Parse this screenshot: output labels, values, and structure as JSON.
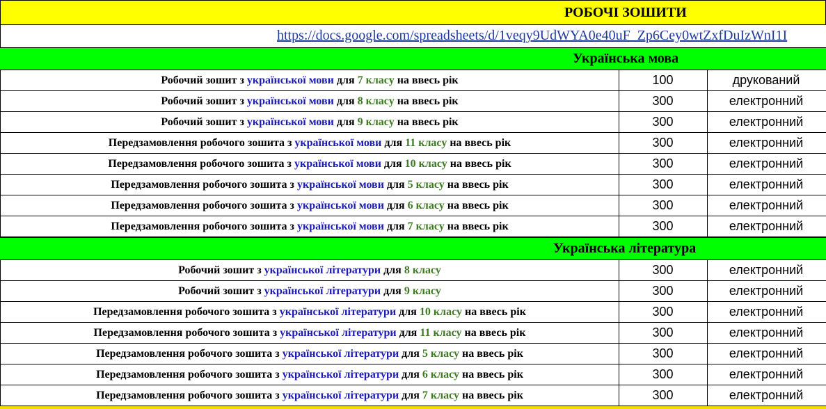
{
  "title": "РОБОЧІ ЗОШИТИ",
  "link": "https://docs.google.com/spreadsheets/d/1veqy9UdWYA0e40uF_Zp6Cey0wtZxfDuIzWnI1I",
  "colors": {
    "title_bg": "#ffff00",
    "section_bg": "#00ff00",
    "subject_text": "#1c1cb4",
    "class_text": "#3d7a22"
  },
  "sections": [
    {
      "title": "Українська мова",
      "items": [
        {
          "pre": "Робочий зошит з",
          "subject": "української мови",
          "mid": "для",
          "cls": "7 класу",
          "post": "на ввесь рік",
          "price": "100",
          "type": "друкований"
        },
        {
          "pre": "Робочий зошит з",
          "subject": "української мови",
          "mid": "для",
          "cls": "8 класу",
          "post": "на ввесь рік",
          "price": "300",
          "type": "електронний"
        },
        {
          "pre": "Робочий зошит з",
          "subject": "української мови",
          "mid": "для",
          "cls": "9 класу",
          "post": "на ввесь рік",
          "price": "300",
          "type": "електронний"
        },
        {
          "pre": "Передзамовлення робочого зошита з",
          "subject": "української мови",
          "mid": "для",
          "cls": "11 класу",
          "post": "на ввесь рік",
          "price": "300",
          "type": "електронний"
        },
        {
          "pre": "Передзамовлення робочого зошита з",
          "subject": "української мови",
          "mid": "для",
          "cls": "10 класу",
          "post": "на ввесь рік",
          "price": "300",
          "type": "електронний"
        },
        {
          "pre": "Передзамовлення робочого зошита з",
          "subject": "української мови",
          "mid": "для",
          "cls": "5 класу",
          "post": "на ввесь рік",
          "price": "300",
          "type": "електронний"
        },
        {
          "pre": "Передзамовлення робочого зошита з",
          "subject": "української мови",
          "mid": "для",
          "cls": "6 класу",
          "post": "на ввесь рік",
          "price": "300",
          "type": "електронний"
        },
        {
          "pre": "Передзамовлення робочого зошита з",
          "subject": "української мови",
          "mid": "для",
          "cls": "7 класу",
          "post": "на ввесь рік",
          "price": "300",
          "type": "електронний"
        }
      ]
    },
    {
      "title": "Українська література",
      "items": [
        {
          "pre": "Робочий зошит з",
          "subject": "української літератури",
          "mid": "для",
          "cls": "8 класу",
          "post": "",
          "price": "300",
          "type": "електронний"
        },
        {
          "pre": "Робочий зошит з",
          "subject": "української літератури",
          "mid": "для",
          "cls": "9 класу",
          "post": "",
          "price": "300",
          "type": "електронний"
        },
        {
          "pre": "Передзамовлення робочого зошита з",
          "subject": "української літератури",
          "mid": "для",
          "cls": "10 класу",
          "post": "на ввесь рік",
          "price": "300",
          "type": "електронний"
        },
        {
          "pre": "Передзамовлення робочого зошита з",
          "subject": "української літератури",
          "mid": "для",
          "cls": "11 класу",
          "post": "на ввесь рік",
          "price": "300",
          "type": "електронний"
        },
        {
          "pre": "Передзамовлення робочого зошита з",
          "subject": "української літератури",
          "mid": "для",
          "cls": "5 класу",
          "post": "на ввесь рік",
          "price": "300",
          "type": "електронний"
        },
        {
          "pre": "Передзамовлення робочого зошита з",
          "subject": "української літератури",
          "mid": "для",
          "cls": "6 класу",
          "post": "на ввесь рік",
          "price": "300",
          "type": "електронний"
        },
        {
          "pre": "Передзамовлення робочого зошита з",
          "subject": "української літератури",
          "mid": "для",
          "cls": "7 класу",
          "post": "на ввесь рік",
          "price": "300",
          "type": "електронний"
        }
      ]
    }
  ]
}
